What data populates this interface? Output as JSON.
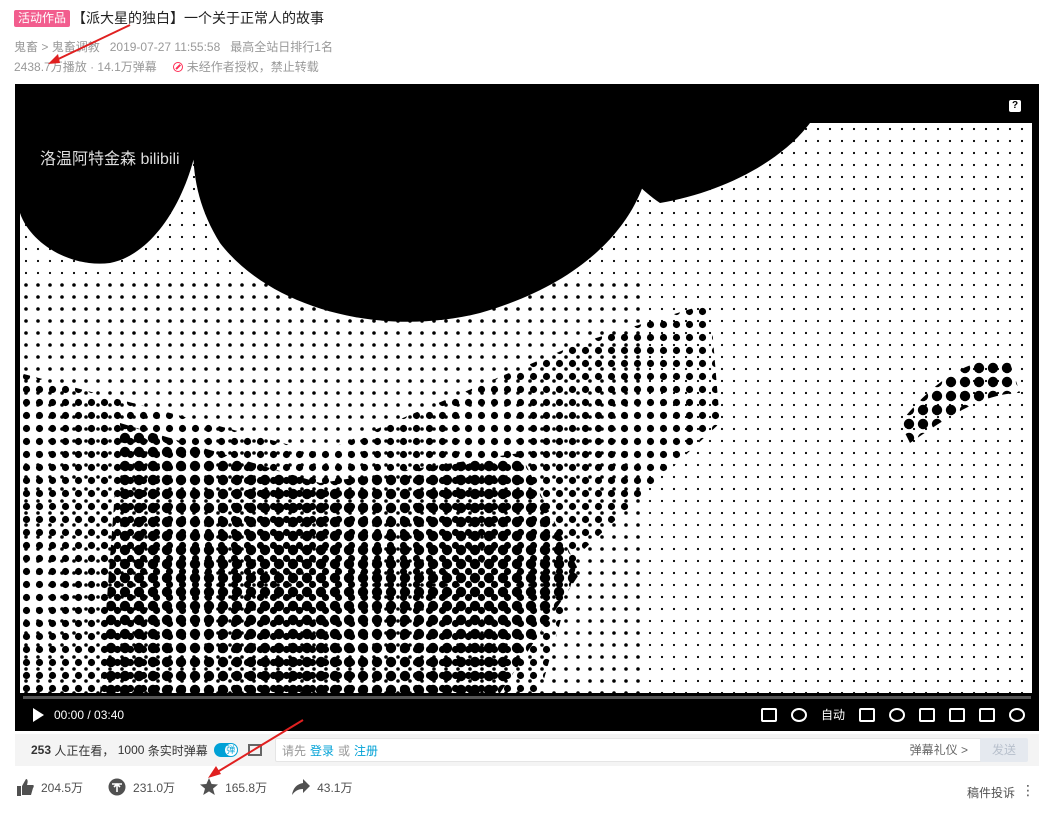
{
  "video": {
    "badge": "活动作品",
    "title": "【派大星的独白】一个关于正常人的故事",
    "category": "鬼畜",
    "subcategory": "鬼畜调教",
    "publish_time": "2019-07-27 11:55:58",
    "rank": "最高全站日排行1名",
    "plays": "2438.7万播放",
    "danmaku_count": "· 14.1万弹幕",
    "copyright_notice": "未经作者授权，禁止转载"
  },
  "player": {
    "help_label": "?",
    "watermark": "洛温阿特金森 bilibili",
    "time": "00:00 / 03:40",
    "auto_label": "自动"
  },
  "danmu": {
    "watching": "253",
    "watching_suffix": "人正在看，",
    "realtime": "1000",
    "realtime_suffix": "条实时弹幕",
    "placeholder_prefix": "请先",
    "login": "登录",
    "or": "或",
    "register": "注册",
    "etiquette": "弹幕礼仪 >",
    "send": "发送"
  },
  "actions": {
    "likes": "204.5万",
    "coins": "231.0万",
    "favorites": "165.8万",
    "shares": "43.1万",
    "report": "稿件投诉",
    "more": "⋮"
  }
}
